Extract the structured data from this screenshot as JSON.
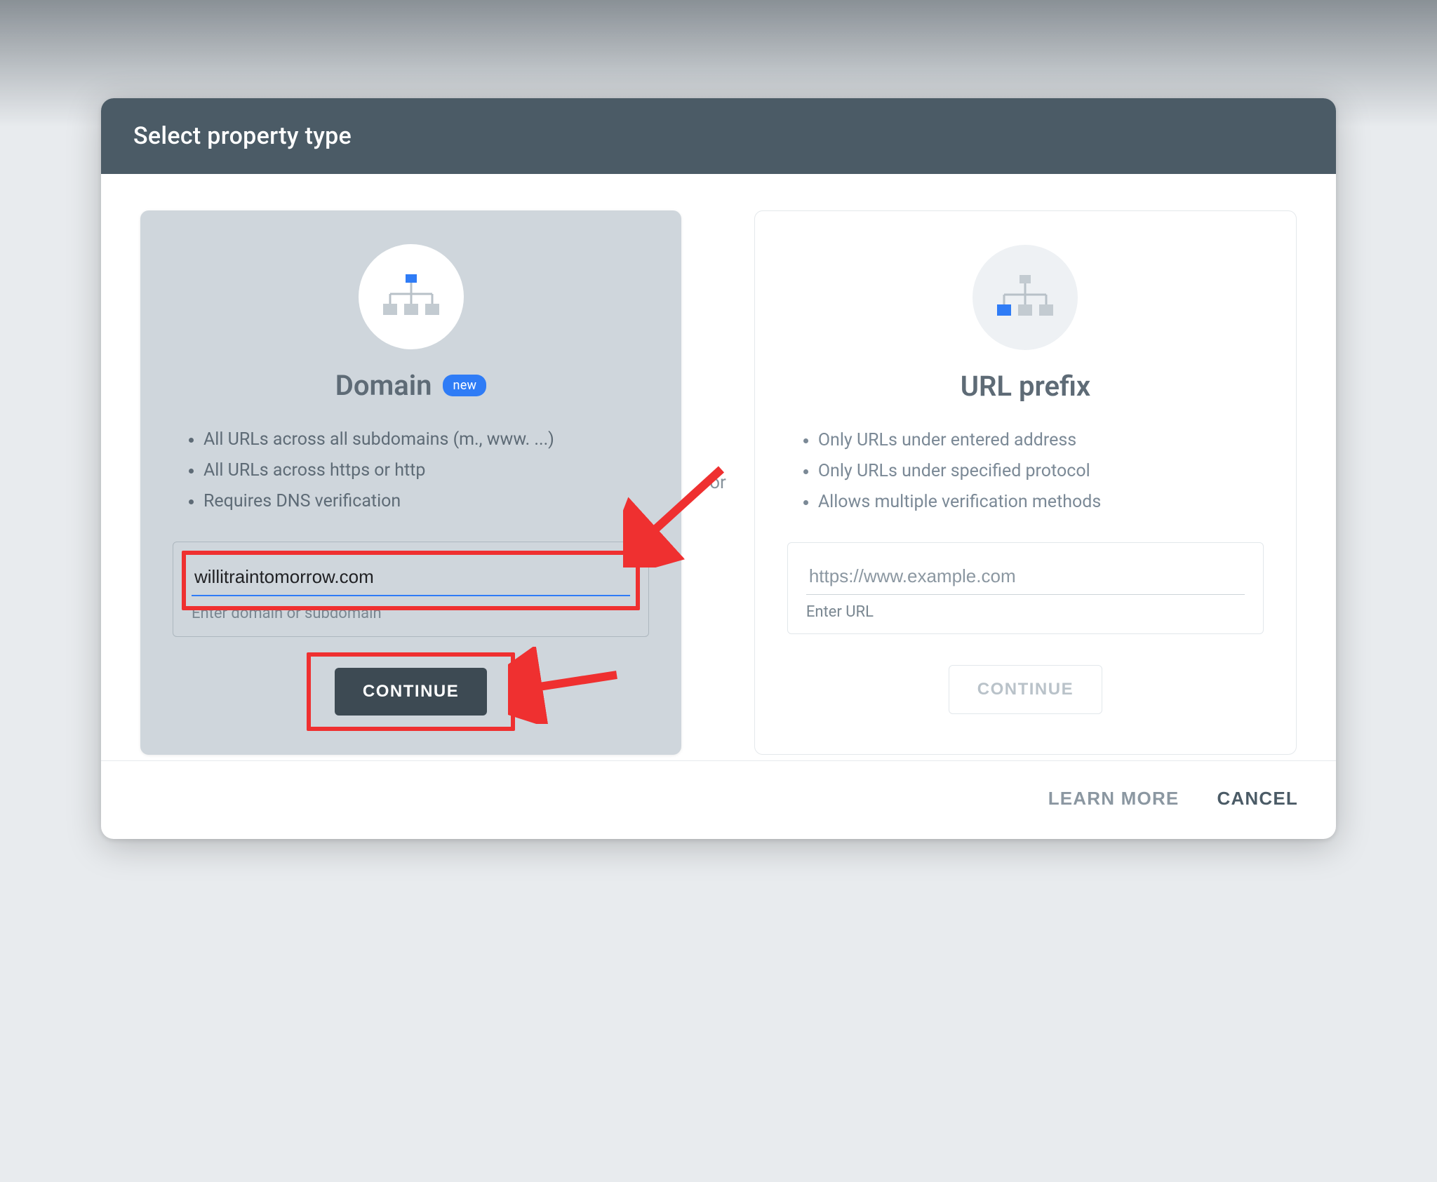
{
  "dialog": {
    "title": "Select property type",
    "separator": "or",
    "footer": {
      "learn_more": "LEARN MORE",
      "cancel": "CANCEL"
    }
  },
  "domain_card": {
    "title": "Domain",
    "badge": "new",
    "features": [
      "All URLs across all subdomains (m., www. ...)",
      "All URLs across https or http",
      "Requires DNS verification"
    ],
    "input_value": "willitraintomorrow.com",
    "helper": "Enter domain or subdomain",
    "continue_label": "CONTINUE"
  },
  "url_card": {
    "title": "URL prefix",
    "features": [
      "Only URLs under entered address",
      "Only URLs under specified protocol",
      "Allows multiple verification methods"
    ],
    "placeholder": "https://www.example.com",
    "helper": "Enter URL",
    "continue_label": "CONTINUE"
  },
  "annotations": {
    "highlight_input": true,
    "highlight_continue": true
  }
}
